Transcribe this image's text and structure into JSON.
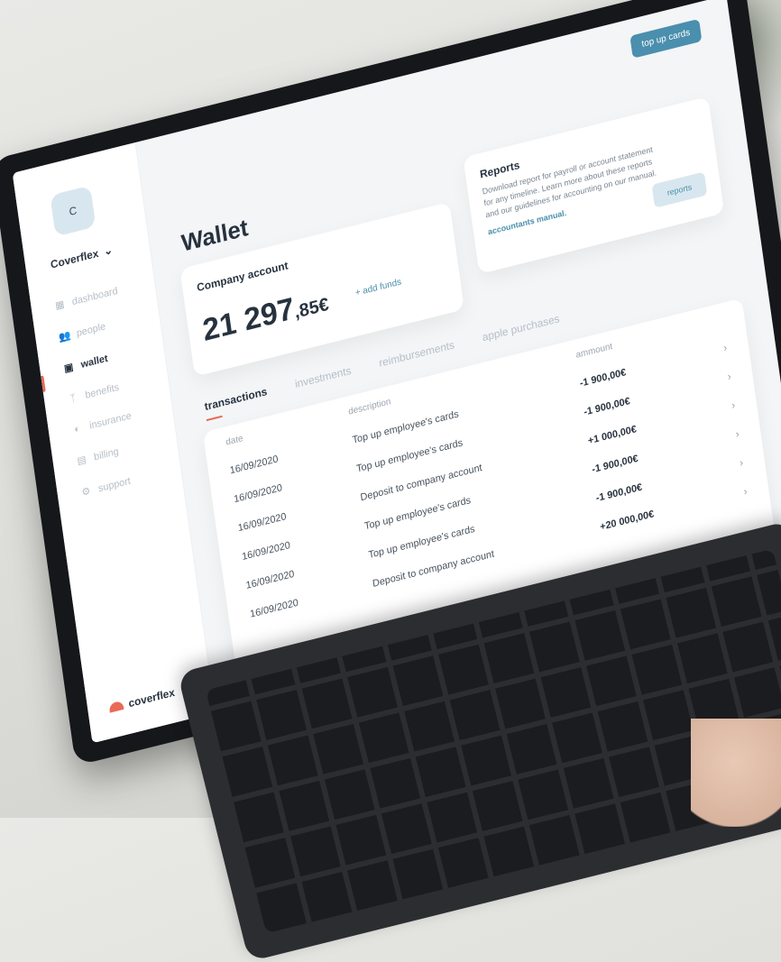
{
  "sidebar": {
    "avatar_initial": "C",
    "company_name": "Coverflex",
    "items": [
      {
        "label": "dashboard",
        "icon": "grid-icon"
      },
      {
        "label": "people",
        "icon": "people-icon"
      },
      {
        "label": "wallet",
        "icon": "wallet-icon"
      },
      {
        "label": "benefits",
        "icon": "sprout-icon"
      },
      {
        "label": "insurance",
        "icon": "shield-icon"
      },
      {
        "label": "billing",
        "icon": "doc-icon"
      },
      {
        "label": "support",
        "icon": "gear-icon"
      }
    ],
    "brand": "coverflex"
  },
  "header": {
    "top_up_cards_label": "top up cards"
  },
  "page": {
    "title": "Wallet"
  },
  "account": {
    "label": "Company account",
    "amount_int": "21 297",
    "amount_dec": ",85€",
    "add_funds": "+ add funds"
  },
  "reports": {
    "title": "Reports",
    "description": "Download report for payroll or account statement for any timeline. Learn more about these reports and our guidelines for accounting on our manual.",
    "link": "accountants manual.",
    "button": "reports"
  },
  "tabs": [
    {
      "label": "transactions",
      "active": true
    },
    {
      "label": "investments",
      "active": false
    },
    {
      "label": "reimbursements",
      "active": false
    },
    {
      "label": "apple purchases",
      "active": false
    }
  ],
  "table": {
    "headers": [
      "date",
      "description",
      "ammount"
    ],
    "rows": [
      {
        "date": "16/09/2020",
        "description": "Top up employee's cards",
        "amount": "-1 900,00€"
      },
      {
        "date": "16/09/2020",
        "description": "Top up employee's cards",
        "amount": "-1 900,00€"
      },
      {
        "date": "16/09/2020",
        "description": "Deposit to company account",
        "amount": "+1 000,00€"
      },
      {
        "date": "16/09/2020",
        "description": "Top up employee's cards",
        "amount": "-1 900,00€"
      },
      {
        "date": "16/09/2020",
        "description": "Top up employee's cards",
        "amount": "-1 900,00€"
      },
      {
        "date": "16/09/2020",
        "description": "Deposit to company account",
        "amount": "+20 000,00€"
      }
    ]
  },
  "colors": {
    "accent_blue": "#4a8fad",
    "accent_coral": "#e86a57",
    "text_dark": "#27323f"
  }
}
